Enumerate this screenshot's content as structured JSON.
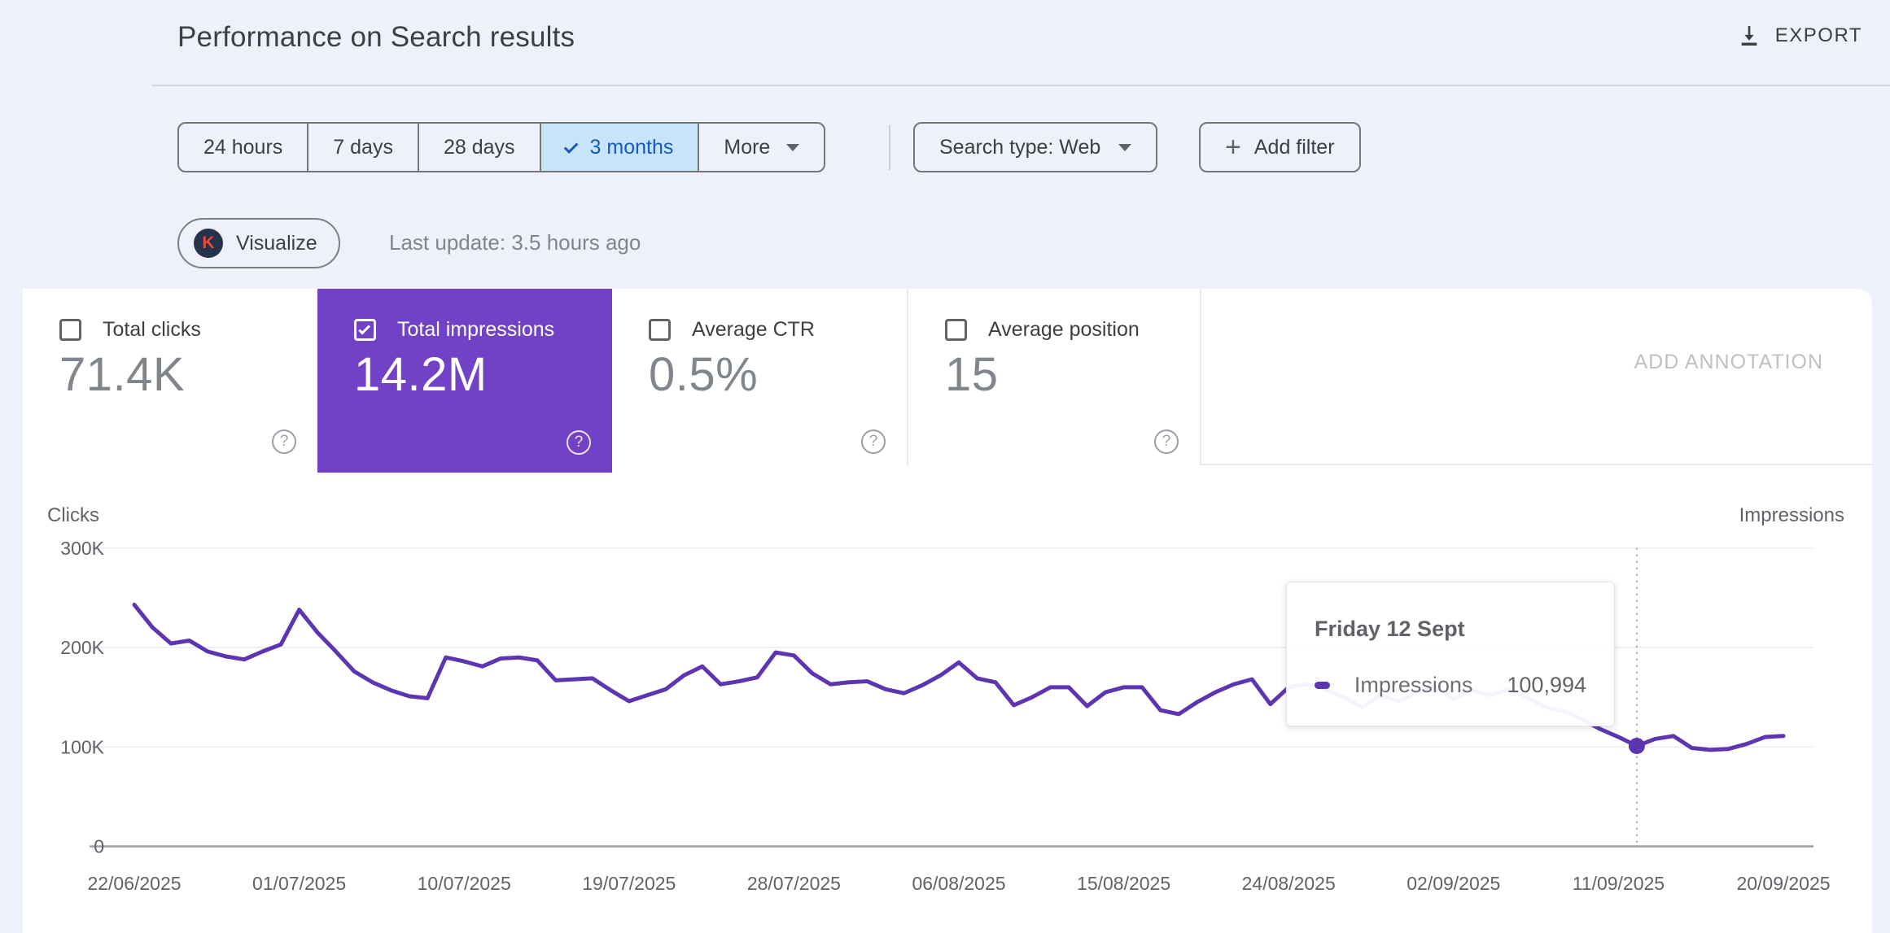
{
  "header": {
    "title": "Performance on Search results",
    "export_label": "EXPORT"
  },
  "filters": {
    "date_ranges": [
      {
        "label": "24 hours",
        "selected": false
      },
      {
        "label": "7 days",
        "selected": false
      },
      {
        "label": "28 days",
        "selected": false
      },
      {
        "label": "3 months",
        "selected": true
      }
    ],
    "more_label": "More",
    "search_type_label": "Search type: Web",
    "add_filter_label": "Add filter"
  },
  "toolbar": {
    "visualize_label": "Visualize",
    "visualize_badge": "K",
    "last_update": "Last update: 3.5 hours ago"
  },
  "metrics": {
    "cards": [
      {
        "label": "Total clicks",
        "value": "71.4K",
        "checked": false,
        "selected": false
      },
      {
        "label": "Total impressions",
        "value": "14.2M",
        "checked": true,
        "selected": true
      },
      {
        "label": "Average CTR",
        "value": "0.5%",
        "checked": false,
        "selected": false
      },
      {
        "label": "Average position",
        "value": "15",
        "checked": false,
        "selected": false
      }
    ],
    "add_annotation_label": "ADD ANNOTATION"
  },
  "chart_data": {
    "type": "line",
    "left_axis_label": "Clicks",
    "right_axis_label": "Impressions",
    "ylim": [
      0,
      300000
    ],
    "y_ticks": [
      {
        "label": "300K",
        "value": 300
      },
      {
        "label": "200K",
        "value": 200
      },
      {
        "label": "100K",
        "value": 100
      },
      {
        "label": "0",
        "value": 0
      }
    ],
    "x_ticks": [
      "22/06/2025",
      "01/07/2025",
      "10/07/2025",
      "19/07/2025",
      "28/07/2025",
      "06/08/2025",
      "15/08/2025",
      "24/08/2025",
      "02/09/2025",
      "11/09/2025",
      "20/09/2025"
    ],
    "grid": true,
    "legend_position": "tooltip-only",
    "series": [
      {
        "name": "Impressions",
        "color": "#5e35b1",
        "unit_thousands": true,
        "values_thousands": [
          243,
          220,
          204,
          207,
          196,
          191,
          188,
          196,
          203,
          238,
          215,
          196,
          176,
          165,
          157,
          151,
          149,
          190,
          186,
          181,
          189,
          190,
          187,
          167,
          168,
          169,
          157,
          146,
          152,
          158,
          172,
          181,
          163,
          166,
          170,
          195,
          192,
          174,
          163,
          165,
          166,
          158,
          154,
          162,
          172,
          185,
          169,
          165,
          142,
          150,
          160,
          160,
          141,
          155,
          160,
          160,
          137,
          133,
          145,
          155,
          163,
          168,
          143,
          160,
          163,
          158,
          150,
          140,
          152,
          146,
          155,
          160,
          148,
          157,
          152,
          158,
          150,
          140,
          136,
          128,
          118,
          110,
          101,
          108,
          111,
          99,
          97,
          98,
          103,
          110,
          111
        ]
      }
    ],
    "tooltip": {
      "title": "Friday 12 Sept",
      "series": "Impressions",
      "value": "100,994",
      "day_index": 82
    }
  },
  "colors": {
    "selected_card_bg": "#7142c6",
    "line_purple": "#5e35b1",
    "selected_range_bg": "#c7e4fb",
    "selected_range_text": "#185abc",
    "page_bg": "#eef1fb"
  }
}
